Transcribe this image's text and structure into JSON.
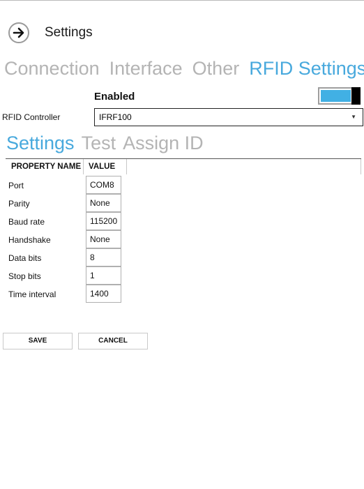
{
  "header": {
    "title": "Settings",
    "back_icon": "arrow-right-circle-icon"
  },
  "main_tabs": [
    {
      "label": "Connection",
      "active": false
    },
    {
      "label": "Interface",
      "active": false
    },
    {
      "label": "Other",
      "active": false
    },
    {
      "label": "RFID Settings",
      "active": true
    }
  ],
  "enabled": {
    "label": "Enabled",
    "on": true
  },
  "controller": {
    "label": "RFID Controller",
    "selected": "IFRF100"
  },
  "sub_tabs": [
    {
      "label": "Settings",
      "active": true
    },
    {
      "label": "Test",
      "active": false
    },
    {
      "label": "Assign ID",
      "active": false
    }
  ],
  "grid": {
    "col_name": "PROPERTY NAME",
    "col_value": "VALUE",
    "rows": [
      {
        "name": "Port",
        "value": "COM8"
      },
      {
        "name": "Parity",
        "value": "None"
      },
      {
        "name": "Baud rate",
        "value": "115200"
      },
      {
        "name": "Handshake",
        "value": "None"
      },
      {
        "name": "Data bits",
        "value": "8"
      },
      {
        "name": "Stop bits",
        "value": "1"
      },
      {
        "name": "Time interval",
        "value": "1400"
      }
    ]
  },
  "buttons": {
    "save": "SAVE",
    "cancel": "CANCEL"
  },
  "colors": {
    "accent": "#48a9dd",
    "toggle_fill": "#41b0e4",
    "inactive_tab": "#b4b4b4"
  }
}
